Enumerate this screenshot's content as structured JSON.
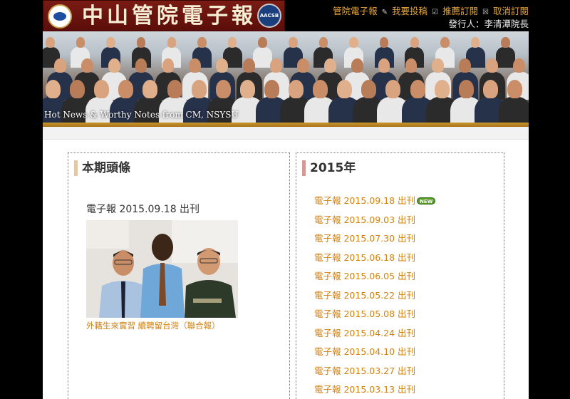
{
  "header": {
    "title": "中山管院電子報",
    "badge_text": "AACSB",
    "links": [
      "管院電子報",
      "我要投稿",
      "推薦訂閱",
      "取消訂閱"
    ],
    "publisher": "發行人：李清潭院長"
  },
  "banner": {
    "caption": "Hot News & Worthy Notes from CM, NSYSU"
  },
  "left_panel": {
    "heading": "本期頭條",
    "issue_title": "電子報 2015.09.18 出刊",
    "photo_caption": "外籍生來實習 續聘留台灣（聯合報）"
  },
  "right_panel": {
    "heading": "2015年",
    "new_label": "NEW",
    "issues": [
      "電子報 2015.09.18 出刊",
      "電子報 2015.09.03 出刊",
      "電子報 2015.07.30 出刊",
      "電子報 2015.06.18 出刊",
      "電子報 2015.06.05 出刊",
      "電子報 2015.05.22 出刊",
      "電子報 2015.05.08 出刊",
      "電子報 2015.04.24 出刊",
      "電子報 2015.04.10 出刊",
      "電子報 2015.03.27 出刊",
      "電子報 2015.03.13 出刊"
    ]
  },
  "colors": {
    "link": "#d2800f",
    "accent_gold": "#e3a43c",
    "header_maroon": "#6b1410"
  }
}
